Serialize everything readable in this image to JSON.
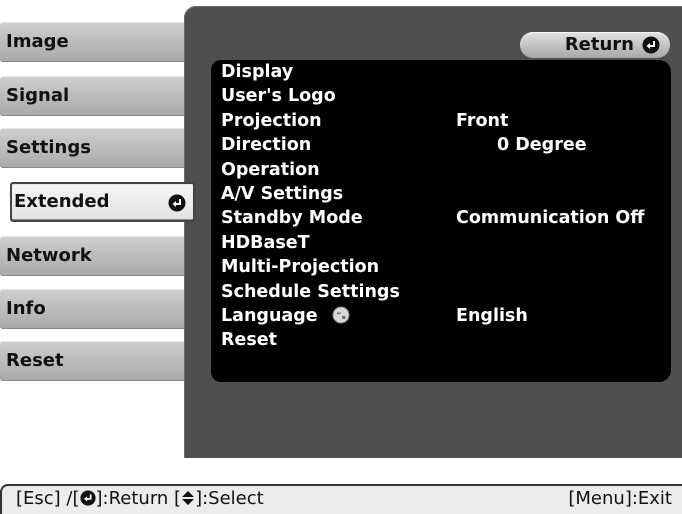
{
  "tabs": [
    {
      "label": "Image"
    },
    {
      "label": "Signal"
    },
    {
      "label": "Settings"
    },
    {
      "label": "Extended",
      "active": true
    },
    {
      "label": "Network"
    },
    {
      "label": "Info"
    },
    {
      "label": "Reset"
    }
  ],
  "return_label": "Return",
  "menu": [
    {
      "label": "Display",
      "value": ""
    },
    {
      "label": "User's Logo",
      "value": ""
    },
    {
      "label": "Projection",
      "value": "Front"
    },
    {
      "label": "Direction",
      "value": "0 Degree"
    },
    {
      "label": "Operation",
      "value": ""
    },
    {
      "label": "A/V Settings",
      "value": ""
    },
    {
      "label": "Standby Mode",
      "value": "Communication Off"
    },
    {
      "label": "HDBaseT",
      "value": ""
    },
    {
      "label": "Multi-Projection",
      "value": ""
    },
    {
      "label": "Schedule Settings",
      "value": ""
    },
    {
      "label": "Language",
      "value": "English"
    },
    {
      "label": "Reset",
      "value": ""
    }
  ],
  "help": {
    "esc": "[Esc] /[",
    "return": "]:Return  [",
    "select": "]:Select",
    "exit": "[Menu]:Exit"
  },
  "colors": {
    "panel": "#4f4f4f",
    "menu_bg": "#000000",
    "tab": "#b9b9b9",
    "tab_active": "#eeeeee"
  },
  "icons": {
    "enter": "enter-icon",
    "globe": "globe-icon",
    "up_down": "up-down-arrow-icon"
  }
}
